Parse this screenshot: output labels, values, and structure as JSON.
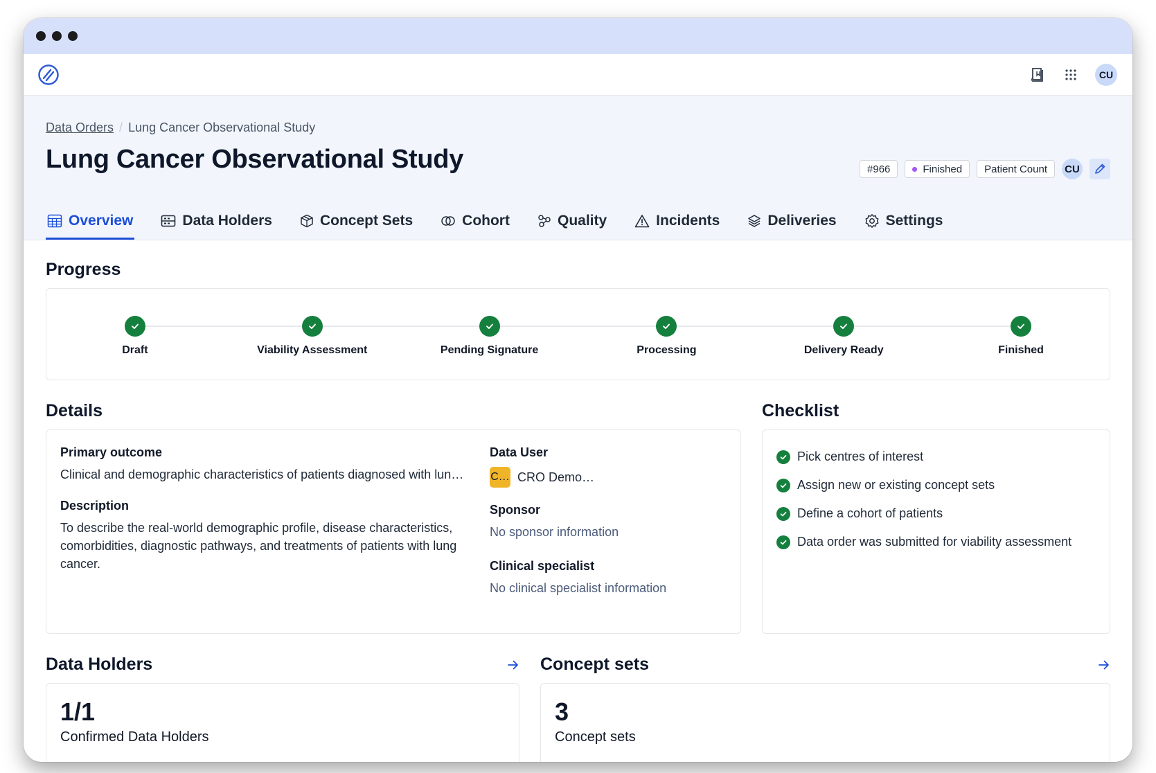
{
  "topnav": {
    "logo": "logo-icon",
    "user_initials": "CU"
  },
  "breadcrumb": {
    "parent": "Data Orders",
    "current": "Lung Cancer Observational Study"
  },
  "page": {
    "title": "Lung Cancer Observational Study",
    "order_id": "#966",
    "status": "Finished",
    "status_color": "#a855f7",
    "type": "Patient Count",
    "owner_initials": "CU"
  },
  "tabs": [
    {
      "label": "Overview",
      "icon": "table-icon",
      "active": true
    },
    {
      "label": "Data Holders",
      "icon": "server-icon",
      "active": false
    },
    {
      "label": "Concept Sets",
      "icon": "cube-icon",
      "active": false
    },
    {
      "label": "Cohort",
      "icon": "venn-icon",
      "active": false
    },
    {
      "label": "Quality",
      "icon": "nodes-icon",
      "active": false
    },
    {
      "label": "Incidents",
      "icon": "warning-icon",
      "active": false
    },
    {
      "label": "Deliveries",
      "icon": "layers-icon",
      "active": false
    },
    {
      "label": "Settings",
      "icon": "gear-icon",
      "active": false
    }
  ],
  "progress": {
    "title": "Progress",
    "steps": [
      {
        "label": "Draft",
        "done": true
      },
      {
        "label": "Viability Assessment",
        "done": true
      },
      {
        "label": "Pending Signature",
        "done": true
      },
      {
        "label": "Processing",
        "done": true
      },
      {
        "label": "Delivery Ready",
        "done": true
      },
      {
        "label": "Finished",
        "done": true
      }
    ]
  },
  "details": {
    "title": "Details",
    "primary_outcome_label": "Primary outcome",
    "primary_outcome": "Clinical and demographic characteristics of patients diagnosed with lun…",
    "description_label": "Description",
    "description": "To describe the real-world demographic profile, disease characteristics, comorbidities, diagnostic pathways, and treatments of patients with lung cancer.",
    "data_user_label": "Data User",
    "data_user_badge": "C…",
    "data_user": "CRO Demo…",
    "sponsor_label": "Sponsor",
    "sponsor": "No sponsor information",
    "clinical_specialist_label": "Clinical specialist",
    "clinical_specialist": "No clinical specialist information"
  },
  "checklist": {
    "title": "Checklist",
    "items": [
      "Pick centres of interest",
      "Assign new or existing concept sets",
      "Define a cohort of patients",
      "Data order was submitted for viability assessment"
    ]
  },
  "data_holders": {
    "title": "Data Holders",
    "value": "1/1",
    "label": "Confirmed Data Holders"
  },
  "concept_sets": {
    "title": "Concept sets",
    "value": "3",
    "label": "Concept sets"
  },
  "colors": {
    "accent": "#1d4ed8",
    "success": "#15803d",
    "titlebar": "#d6e0fb",
    "header_bg": "#f2f6fc"
  }
}
